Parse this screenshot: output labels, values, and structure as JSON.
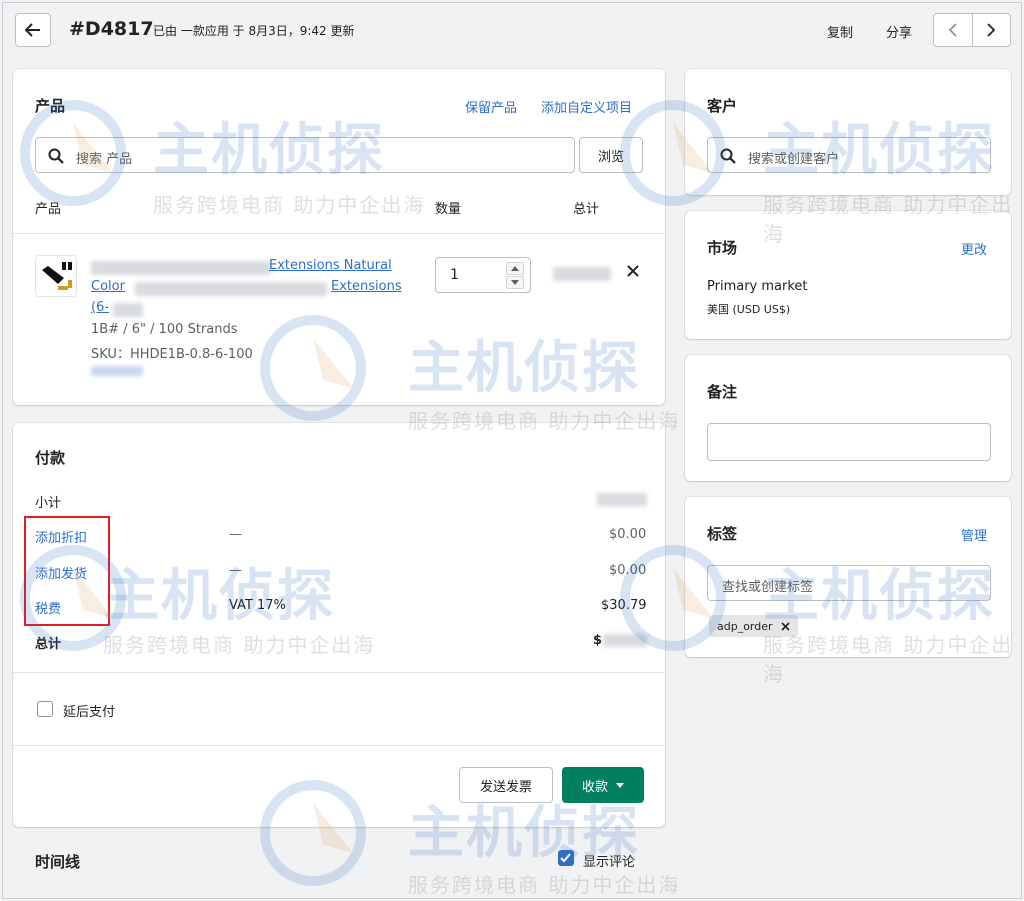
{
  "header": {
    "order_id": "#D4817",
    "subtitle": "已由 一款应用 于 8月3日，9:42 更新",
    "copy_label": "复制",
    "share_label": "分享"
  },
  "products": {
    "title": "产品",
    "keep_link": "保留产品",
    "custom_link": "添加自定义项目",
    "search_placeholder": "搜索 产品",
    "browse_label": "浏览",
    "col_product": "产品",
    "col_quantity": "数量",
    "col_total": "总计",
    "item": {
      "name_line1": "Extensions Natural",
      "name_line2a": "Color",
      "name_line2b": "Extensions",
      "name_line3": "(6-",
      "variant": "1B# / 6\" / 100 Strands",
      "sku": "SKU：HHDE1B-0.8-6-100",
      "quantity": "1"
    }
  },
  "payment": {
    "title": "付款",
    "subtotal_label": "小计",
    "discount_label": "添加折扣",
    "discount_dash": "—",
    "discount_value": "$0.00",
    "shipping_label": "添加发货",
    "shipping_dash": "—",
    "shipping_value": "$0.00",
    "tax_label": "税费",
    "tax_desc": "VAT 17%",
    "tax_value": "$30.79",
    "total_label": "总计",
    "total_value_partial": "$",
    "defer_label": "延后支付",
    "send_invoice_label": "发送发票",
    "collect_label": "收款"
  },
  "timeline": {
    "title": "时间线",
    "show_comments_label": "显示评论"
  },
  "customer": {
    "title": "客户",
    "search_placeholder": "搜索或创建客户"
  },
  "market": {
    "title": "市场",
    "edit_link": "更改",
    "name": "Primary market",
    "region": "美国 (USD US$)"
  },
  "notes": {
    "title": "备注"
  },
  "tags": {
    "title": "标签",
    "manage_link": "管理",
    "search_placeholder": "查找或创建标签",
    "items": [
      "adp_order"
    ]
  },
  "watermark": {
    "brand": "主机侦探",
    "slogan": "服务跨境电商 助力中企出海"
  },
  "colors": {
    "link": "#2c6ecb",
    "primary_button": "#008060",
    "highlight_box": "#e02020"
  }
}
